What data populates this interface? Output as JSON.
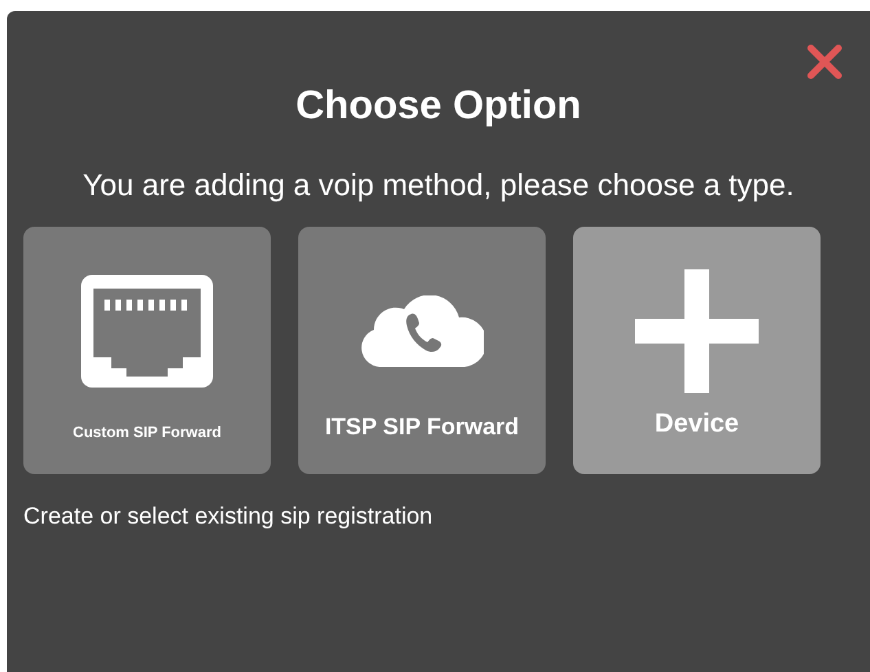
{
  "dialog": {
    "title": "Choose Option",
    "message": "You are adding a voip method, please choose a type.",
    "options": [
      {
        "kind": "ethernet",
        "label": "Custom SIP Forward",
        "selected": false
      },
      {
        "kind": "cloud-phone",
        "label": "ITSP SIP Forward",
        "selected": false
      },
      {
        "kind": "plus",
        "label": "Device",
        "selected": true
      }
    ],
    "hint": "Create or select existing sip registration"
  }
}
